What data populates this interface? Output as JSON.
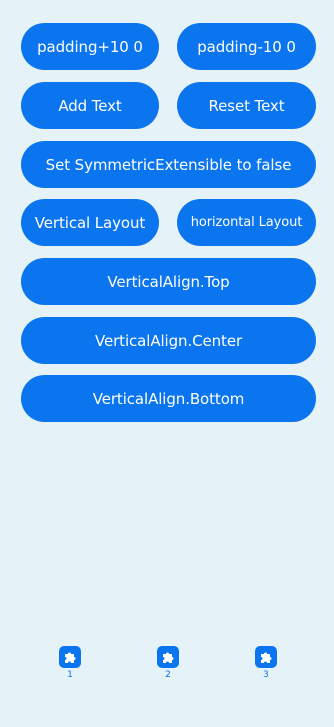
{
  "buttons": {
    "padding_plus": "padding+10 0",
    "padding_minus": "padding-10 0",
    "add_text": "Add Text",
    "reset_text": "Reset Text",
    "set_symmetric": "Set SymmetricExtensible to false",
    "vertical_layout": "Vertical Layout",
    "horizontal_layout": "horizontal Layout",
    "valign_top": "VerticalAlign.Top",
    "valign_center": "VerticalAlign.Center",
    "valign_bottom": "VerticalAlign.Bottom"
  },
  "tabs": [
    {
      "label": "1",
      "icon": "puzzle-icon"
    },
    {
      "label": "2",
      "icon": "puzzle-icon"
    },
    {
      "label": "3",
      "icon": "puzzle-icon"
    }
  ],
  "colors": {
    "background": "#e5f3f8",
    "accent": "#0a75ee",
    "button_text": "#ffffff"
  }
}
